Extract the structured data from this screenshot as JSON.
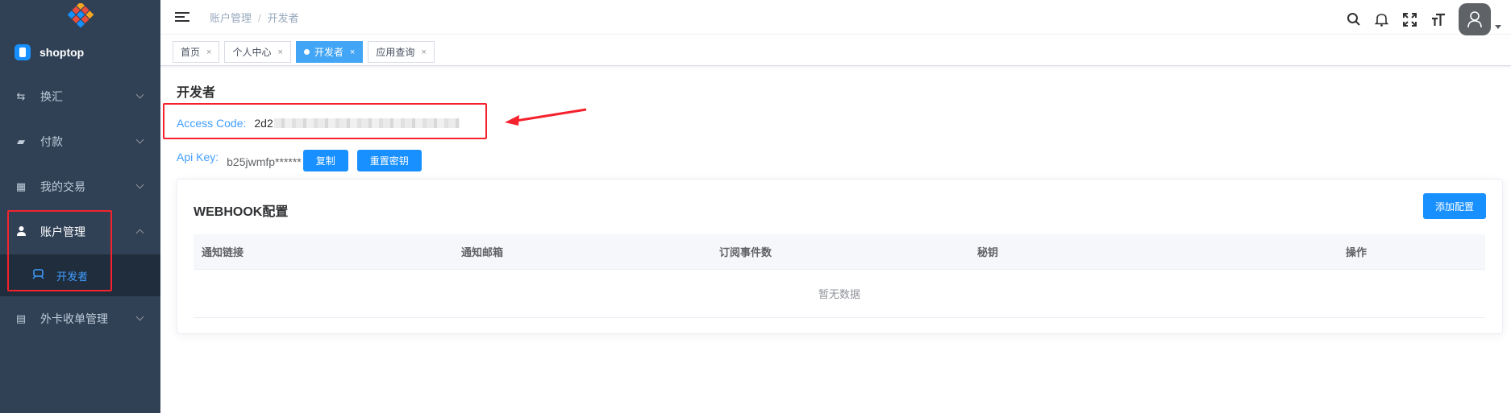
{
  "sidebar": {
    "brand": "shoptop",
    "items": [
      {
        "label": "换汇",
        "icon": "exchange-icon"
      },
      {
        "label": "付款",
        "icon": "payment-icon"
      },
      {
        "label": "我的交易",
        "icon": "grid-icon"
      },
      {
        "label": "账户管理",
        "icon": "user-icon"
      },
      {
        "label": "开发者",
        "icon": "developer-icon"
      },
      {
        "label": "外卡收单管理",
        "icon": "document-icon"
      }
    ]
  },
  "breadcrumb": {
    "parent": "账户管理",
    "current": "开发者",
    "separator": "/"
  },
  "tags": [
    {
      "label": "首页"
    },
    {
      "label": "个人中心"
    },
    {
      "label": "开发者"
    },
    {
      "label": "应用查询"
    }
  ],
  "tag_close": "×",
  "main": {
    "title": "开发者",
    "access_code_label": "Access Code:",
    "access_code_value": "2d2",
    "api_key_label": "Api Key:",
    "api_key_value": "b25jwmfp******",
    "copy_button": "复制",
    "reset_button": "重置密钥"
  },
  "webhook": {
    "title": "WEBHOOK配置",
    "add_button": "添加配置",
    "columns": [
      "通知链接",
      "通知邮箱",
      "订阅事件数",
      "秘钥",
      "操作"
    ],
    "empty_text": "暂无数据"
  },
  "colors": {
    "sidebar_bg": "#304156",
    "primary": "#1890ff",
    "active_tag": "#42a5f5",
    "highlight": "#f5222d"
  }
}
